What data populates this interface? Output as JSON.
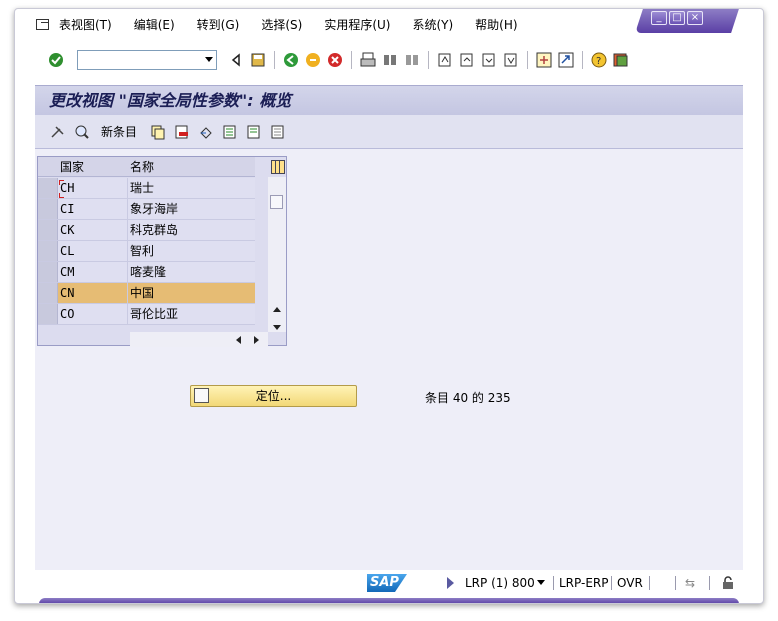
{
  "menu": {
    "items": [
      "表视图(T)",
      "编辑(E)",
      "转到(G)",
      "选择(S)",
      "实用程序(U)",
      "系统(Y)",
      "帮助(H)"
    ]
  },
  "toolbar": {
    "command_value": ""
  },
  "screen": {
    "title": "更改视图 \"国家全局性参数\": 概览"
  },
  "app_toolbar": {
    "new_entries_label": "新条目"
  },
  "table": {
    "headers": [
      "国家",
      "名称"
    ],
    "rows": [
      {
        "code": "CH",
        "name": "瑞士"
      },
      {
        "code": "CI",
        "name": "象牙海岸"
      },
      {
        "code": "CK",
        "name": "科克群岛"
      },
      {
        "code": "CL",
        "name": "智利"
      },
      {
        "code": "CM",
        "name": "喀麦隆"
      },
      {
        "code": "CN",
        "name": "中国"
      },
      {
        "code": "CO",
        "name": "哥伦比亚"
      }
    ],
    "selected_row": 5
  },
  "position_button": {
    "label": "定位..."
  },
  "entry_info": "条目 40 的 235",
  "status": {
    "logo": "SAP",
    "session": "LRP (1) 800",
    "system": "LRP-ERP",
    "mode": "OVR"
  },
  "colors": {
    "title_bg": "#c4c6e2",
    "selected_row": "#e6bc74",
    "button_bg": "#f2d877"
  }
}
